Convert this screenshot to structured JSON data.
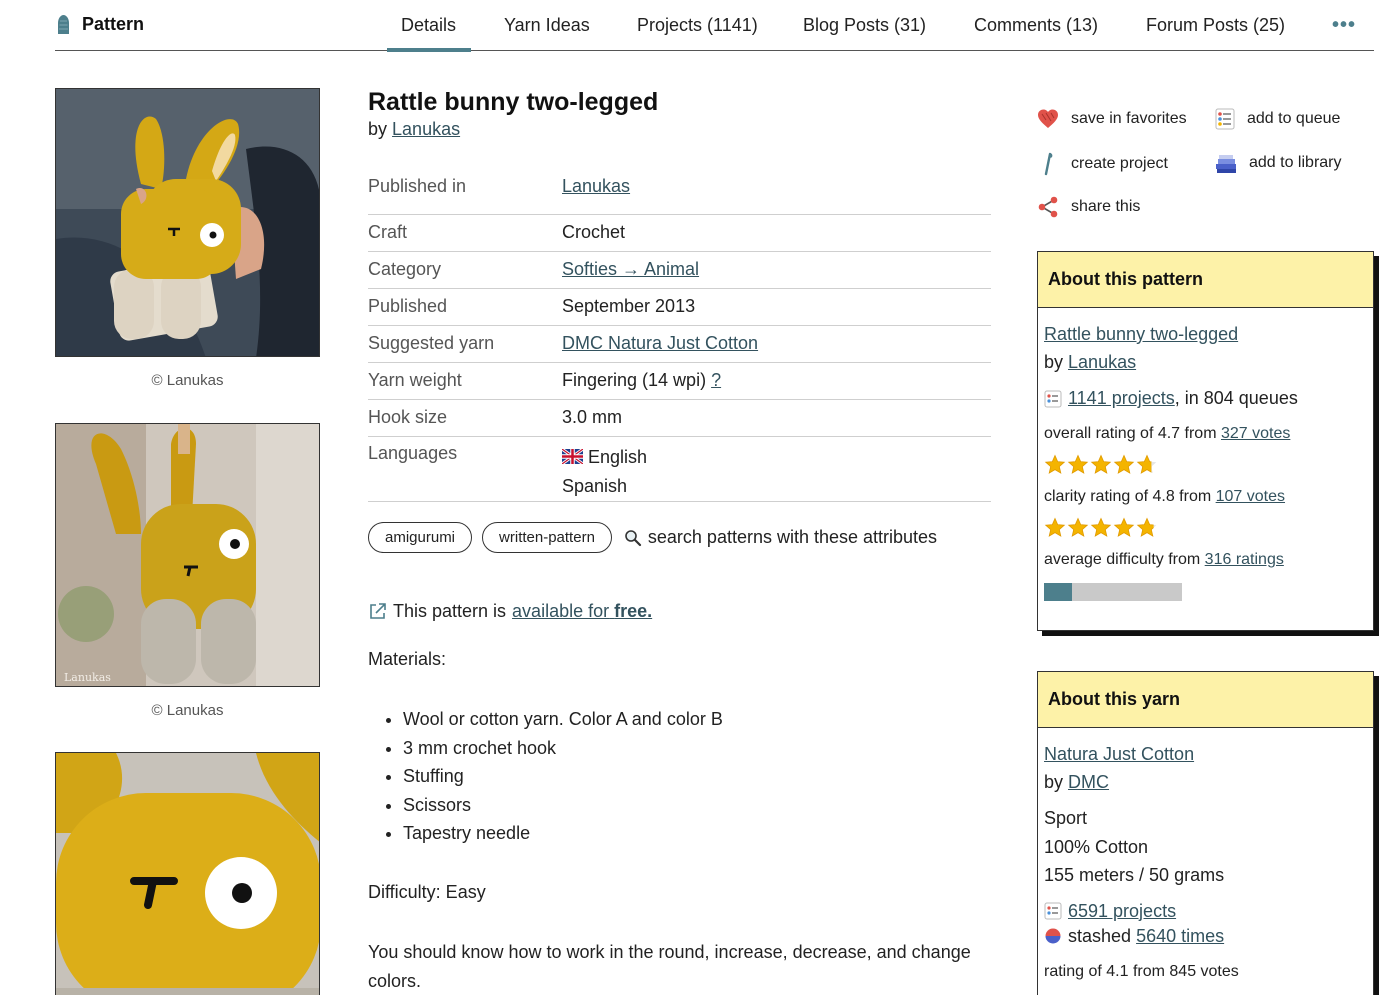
{
  "nav": {
    "brand": "Pattern",
    "tabs": [
      "Details",
      "Yarn Ideas",
      "Projects (1141)",
      "Blog Posts (31)",
      "Comments (13)",
      "Forum Posts (25)"
    ],
    "more": "•••"
  },
  "photos": {
    "captions": [
      "© Lanukas",
      "© Lanukas"
    ],
    "watermark": "Lanukas"
  },
  "pattern": {
    "title": "Rattle bunny two-legged",
    "by": "by",
    "designer": "Lanukas",
    "meta": {
      "published_in_label": "Published in",
      "published_in": "Lanukas",
      "craft_label": "Craft",
      "craft": "Crochet",
      "category_label": "Category",
      "category": "Softies → Animal",
      "published_label": "Published",
      "published": "September 2013",
      "yarn_label": "Suggested yarn",
      "yarn": "DMC Natura Just Cotton",
      "weight_label": "Yarn weight",
      "weight": "Fingering (14 wpi)",
      "weight_help": "?",
      "hook_label": "Hook size",
      "hook": "3.0 mm",
      "languages_label": "Languages",
      "language_1": "English",
      "language_2": "Spanish"
    },
    "tags": [
      "amigurumi",
      "written-pattern"
    ],
    "tag_search": "search patterns with these attributes",
    "avail_prefix": "This pattern is",
    "avail_link": "available for",
    "avail_free": "free.",
    "materials_heading": "Materials:",
    "materials": [
      "Wool or cotton yarn. Color A and color B",
      "3 mm crochet hook",
      "Stuffing",
      "Scissors",
      "Tapestry needle"
    ],
    "difficulty": "Difficulty: Easy",
    "description": "You should know how to work in the round, increase, decrease, and change colors."
  },
  "actions": {
    "favorites": "save in favorites",
    "queue": "add to queue",
    "project": "create project",
    "library": "add to library",
    "share": "share this"
  },
  "about_pattern": {
    "heading": "About this pattern",
    "name": "Rattle bunny two-legged",
    "by": "by",
    "designer": "Lanukas",
    "projects_link": "1141 projects",
    "queues": ", in 804 queues",
    "overall_prefix": "overall rating of 4.7 from",
    "overall_votes": "327 votes",
    "overall_rating": 4.7,
    "clarity_prefix": "clarity rating of 4.8 from",
    "clarity_votes": "107 votes",
    "clarity_rating": 4.8,
    "difficulty_prefix": "average difficulty from",
    "difficulty_ratings": "316 ratings",
    "difficulty_level": 0.2
  },
  "about_yarn": {
    "heading": "About this yarn",
    "name": "Natura Just Cotton",
    "by": "by",
    "brand": "DMC",
    "weight": "Sport",
    "fiber": "100% Cotton",
    "yardage": "155 meters / 50 grams",
    "projects_link": "6591 projects",
    "stashed_prefix": "stashed",
    "stashed_link": "5640 times",
    "rating": "rating of 4.1 from 845 votes"
  },
  "colors": {
    "accent": "#4d7f8c",
    "card_header": "#fdf2a8",
    "link": "#33525e",
    "star": "#f4b400",
    "heart": "#e0524a"
  }
}
